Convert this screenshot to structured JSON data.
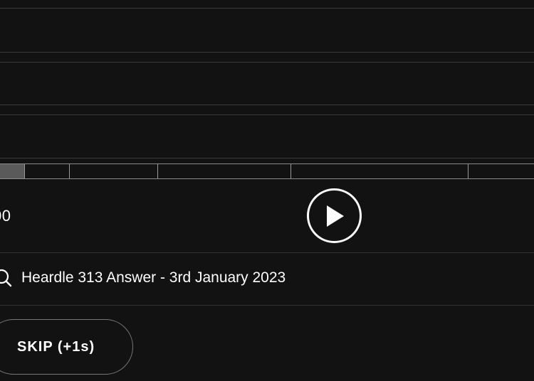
{
  "player": {
    "time_readout": "00",
    "play_icon": "play-icon",
    "progress": {
      "played_fraction": 0.045,
      "segment_seconds": [
        1,
        2,
        4,
        7,
        11,
        16
      ]
    }
  },
  "search": {
    "icon": "search-icon",
    "value": "Heardle 313 Answer - 3rd January 2023"
  },
  "actions": {
    "skip_label": "SKIP (+1s)"
  },
  "colors": {
    "background": "#121212",
    "row_border": "#3a3a3a",
    "progress_border": "#8a8a8a",
    "progress_fill": "#5a5a5a",
    "text": "#ffffff"
  }
}
